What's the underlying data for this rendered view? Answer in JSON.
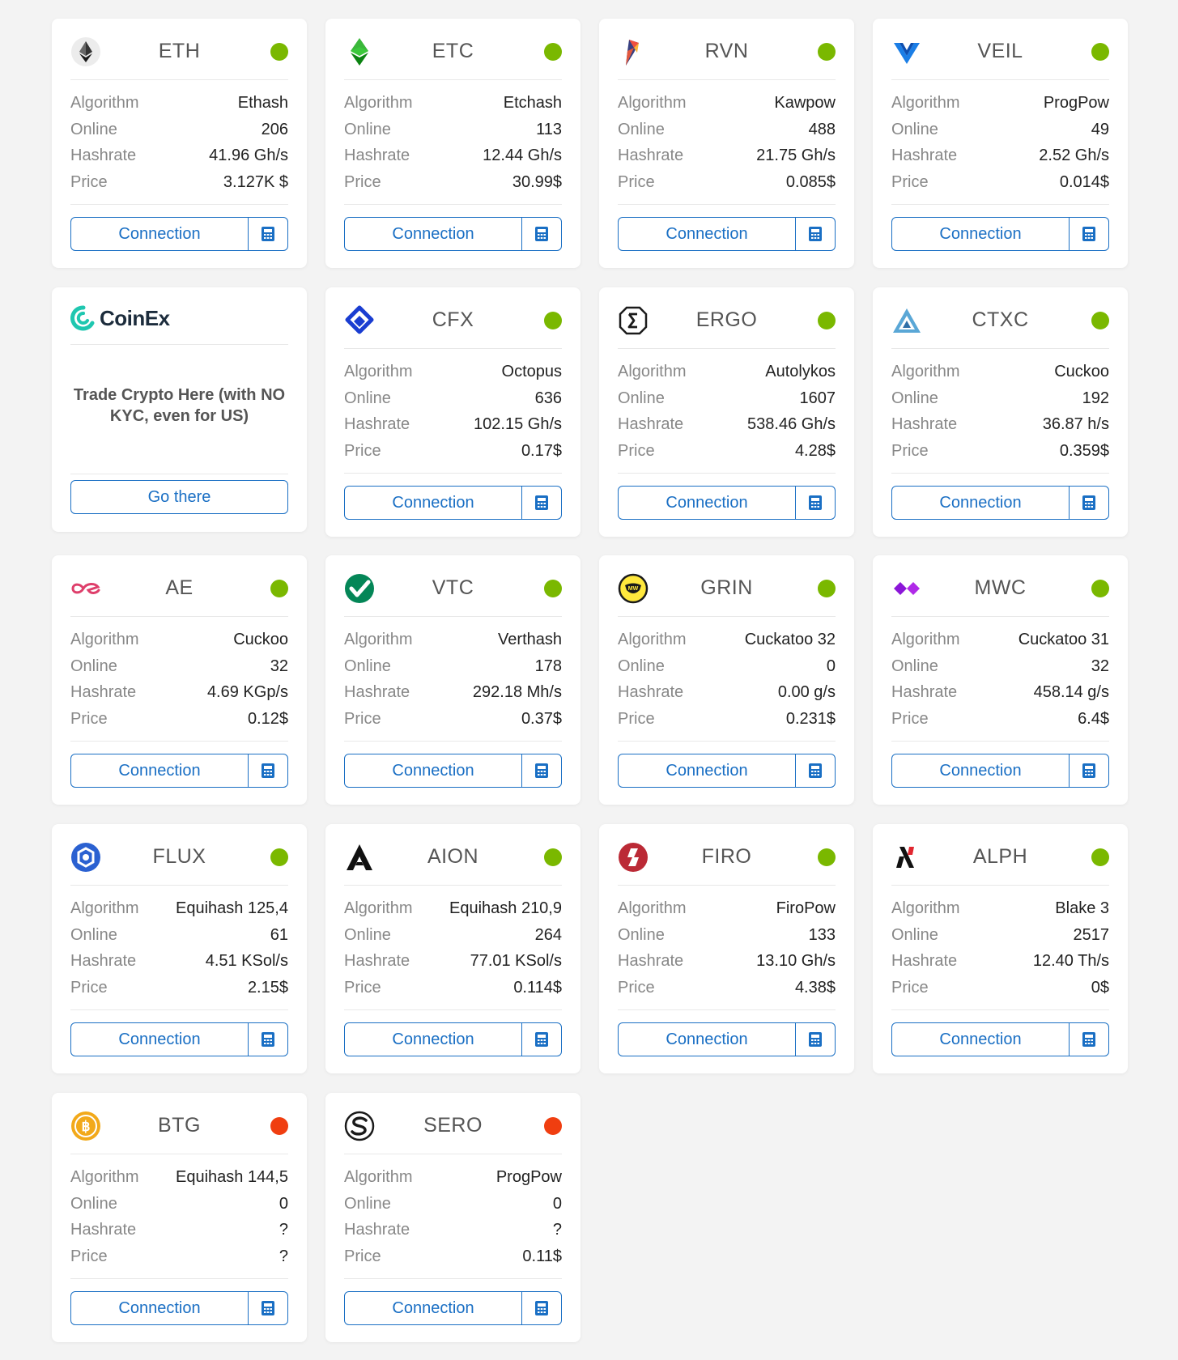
{
  "labels": {
    "algorithm": "Algorithm",
    "online": "Online",
    "hashrate": "Hashrate",
    "price": "Price",
    "connection": "Connection"
  },
  "colors": {
    "online": "#7ab800",
    "offline": "#f03e10",
    "accent": "#1a6fc4"
  },
  "ad": {
    "logo_text": "CoinEx",
    "text": "Trade Crypto Here (with NO KYC, even for US)",
    "button_label": "Go there"
  },
  "coins": [
    {
      "name": "ETH",
      "icon": "ethereum-icon",
      "status": "online",
      "algorithm": "Ethash",
      "online": "206",
      "hashrate": "41.96 Gh/s",
      "price": "3.127K $"
    },
    {
      "name": "ETC",
      "icon": "ethereum-classic-icon",
      "status": "online",
      "algorithm": "Etchash",
      "online": "113",
      "hashrate": "12.44 Gh/s",
      "price": "30.99$"
    },
    {
      "name": "RVN",
      "icon": "ravencoin-icon",
      "status": "online",
      "algorithm": "Kawpow",
      "online": "488",
      "hashrate": "21.75 Gh/s",
      "price": "0.085$"
    },
    {
      "name": "VEIL",
      "icon": "veil-icon",
      "status": "online",
      "algorithm": "ProgPow",
      "online": "49",
      "hashrate": "2.52 Gh/s",
      "price": "0.014$"
    },
    {
      "name": "CFX",
      "icon": "conflux-icon",
      "status": "online",
      "algorithm": "Octopus",
      "online": "636",
      "hashrate": "102.15 Gh/s",
      "price": "0.17$"
    },
    {
      "name": "ERGO",
      "icon": "ergo-icon",
      "status": "online",
      "algorithm": "Autolykos",
      "online": "1607",
      "hashrate": "538.46 Gh/s",
      "price": "4.28$"
    },
    {
      "name": "CTXC",
      "icon": "cortex-icon",
      "status": "online",
      "algorithm": "Cuckoo",
      "online": "192",
      "hashrate": "36.87 h/s",
      "price": "0.359$"
    },
    {
      "name": "AE",
      "icon": "aeternity-icon",
      "status": "online",
      "algorithm": "Cuckoo",
      "online": "32",
      "hashrate": "4.69 KGp/s",
      "price": "0.12$"
    },
    {
      "name": "VTC",
      "icon": "vertcoin-icon",
      "status": "online",
      "algorithm": "Verthash",
      "online": "178",
      "hashrate": "292.18 Mh/s",
      "price": "0.37$"
    },
    {
      "name": "GRIN",
      "icon": "grin-icon",
      "status": "online",
      "algorithm": "Cuckatoo 32",
      "online": "0",
      "hashrate": "0.00 g/s",
      "price": "0.231$"
    },
    {
      "name": "MWC",
      "icon": "mimblewimble-coin-icon",
      "status": "online",
      "algorithm": "Cuckatoo 31",
      "online": "32",
      "hashrate": "458.14 g/s",
      "price": "6.4$"
    },
    {
      "name": "FLUX",
      "icon": "flux-icon",
      "status": "online",
      "algorithm": "Equihash 125,4",
      "online": "61",
      "hashrate": "4.51 KSol/s",
      "price": "2.15$"
    },
    {
      "name": "AION",
      "icon": "aion-icon",
      "status": "online",
      "algorithm": "Equihash 210,9",
      "online": "264",
      "hashrate": "77.01 KSol/s",
      "price": "0.114$"
    },
    {
      "name": "FIRO",
      "icon": "firo-icon",
      "status": "online",
      "algorithm": "FiroPow",
      "online": "133",
      "hashrate": "13.10 Gh/s",
      "price": "4.38$"
    },
    {
      "name": "ALPH",
      "icon": "alephium-icon",
      "status": "online",
      "algorithm": "Blake 3",
      "online": "2517",
      "hashrate": "12.40 Th/s",
      "price": "0$"
    },
    {
      "name": "BTG",
      "icon": "bitcoin-gold-icon",
      "status": "offline",
      "algorithm": "Equihash 144,5",
      "online": "0",
      "hashrate": "?",
      "price": "?"
    },
    {
      "name": "SERO",
      "icon": "sero-icon",
      "status": "offline",
      "algorithm": "ProgPow",
      "online": "0",
      "hashrate": "?",
      "price": "0.11$"
    }
  ]
}
